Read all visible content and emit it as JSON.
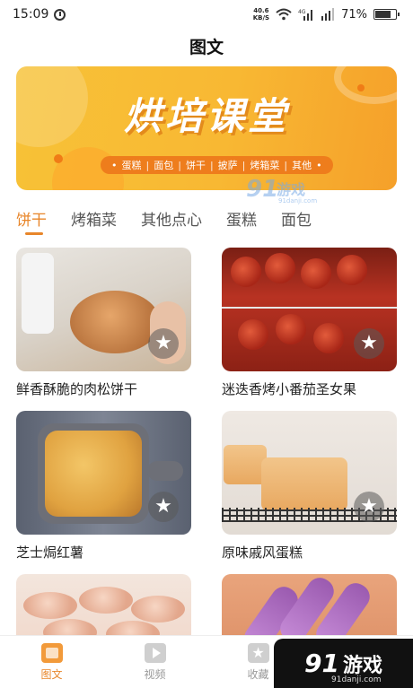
{
  "status_bar": {
    "time": "15:09",
    "net_speed_value": "40.6",
    "net_speed_unit": "KB/S",
    "battery": "71%",
    "icons": [
      "alarm-icon",
      "wifi-icon",
      "signal-4g-icon",
      "signal-icon",
      "battery-icon"
    ]
  },
  "header": {
    "title": "图文"
  },
  "banner": {
    "title": "烘培课堂",
    "tags": [
      "蛋糕",
      "面包",
      "饼干",
      "披萨",
      "烤箱菜",
      "其他"
    ],
    "colors": {
      "background": "#f8b833",
      "tag_bg": "#ee7d1c"
    }
  },
  "tabs": {
    "items": [
      "饼干",
      "烤箱菜",
      "其他点心",
      "蛋糕",
      "面包"
    ],
    "active_index": 0,
    "accent_color": "#e8862a"
  },
  "recipes": [
    {
      "title": "鲜香酥脆的肉松饼干",
      "icon": "star-icon"
    },
    {
      "title": "迷迭香烤小番茄圣女果",
      "icon": "star-icon"
    },
    {
      "title": "芝士焗红薯",
      "icon": "star-icon"
    },
    {
      "title": "原味戚风蛋糕",
      "icon": "star-icon"
    },
    {
      "title": "",
      "icon": "star-icon"
    },
    {
      "title": "",
      "icon": "star-icon"
    }
  ],
  "bottom_nav": {
    "items": [
      {
        "label": "图文",
        "icon": "article-icon",
        "active": true
      },
      {
        "label": "视频",
        "icon": "video-icon",
        "active": false
      },
      {
        "label": "收藏",
        "icon": "star-icon",
        "active": false
      }
    ]
  },
  "watermark": {
    "number": "9",
    "text": "游戏",
    "site": "91danji.com"
  }
}
